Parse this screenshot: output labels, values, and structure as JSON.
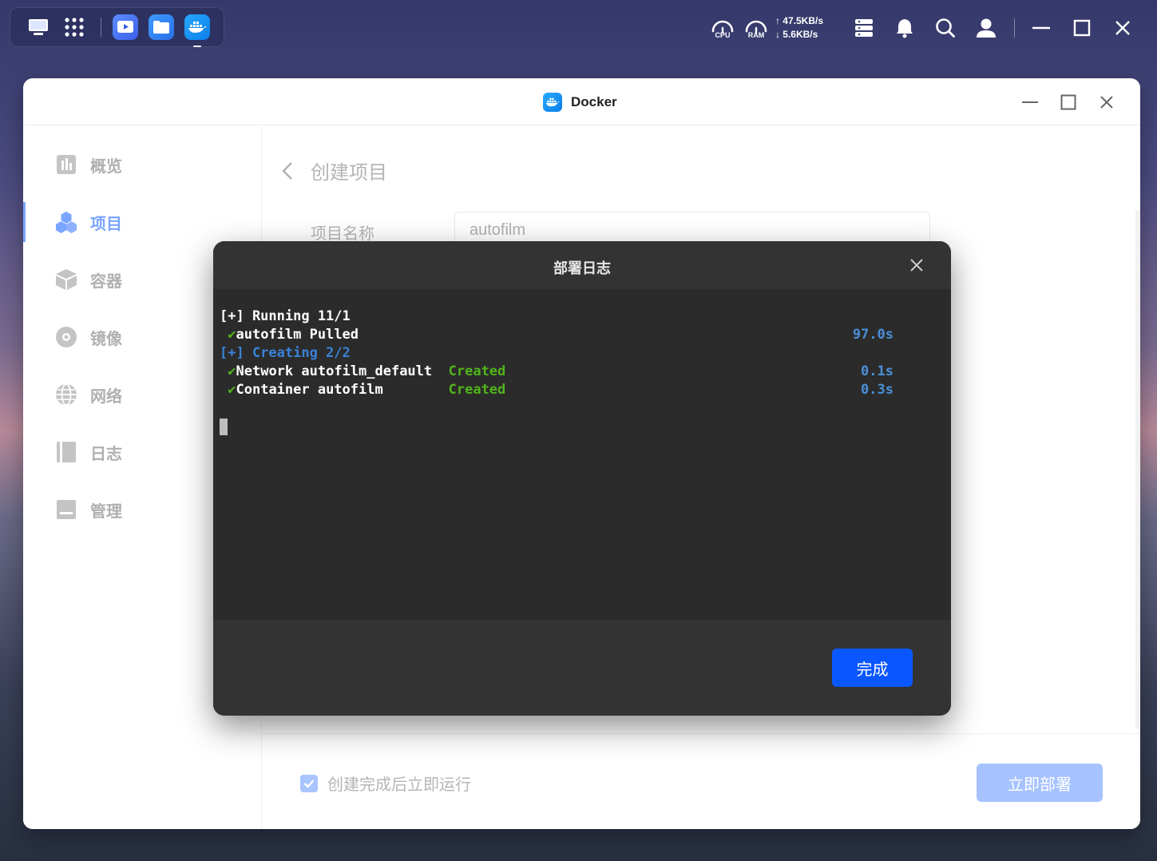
{
  "taskbar": {
    "apps": [
      {
        "name": "video-app"
      },
      {
        "name": "files-app"
      },
      {
        "name": "docker-app"
      }
    ]
  },
  "status": {
    "cpu_label": "CPU",
    "ram_label": "RAM",
    "upload": "47.5KB/s",
    "download": "5.6KB/s"
  },
  "window": {
    "title": "Docker"
  },
  "sidebar": {
    "items": [
      {
        "label": "概览",
        "icon": "chart-icon"
      },
      {
        "label": "项目",
        "icon": "cubes-icon",
        "active": true
      },
      {
        "label": "容器",
        "icon": "box-icon"
      },
      {
        "label": "镜像",
        "icon": "disc-icon"
      },
      {
        "label": "网络",
        "icon": "globe-icon"
      },
      {
        "label": "日志",
        "icon": "log-icon"
      },
      {
        "label": "管理",
        "icon": "manage-icon"
      }
    ]
  },
  "content": {
    "page_title": "创建项目",
    "project_name_label": "项目名称",
    "project_name_value": "autofilm",
    "run_after_create_label": "创建完成后立即运行",
    "run_after_create_checked": true,
    "deploy_button": "立即部署"
  },
  "modal": {
    "title": "部署日志",
    "log": {
      "running": "[+] Running 11/1",
      "pulled_check": "✔",
      "pulled": "autofilm Pulled",
      "pulled_time": "97.0s",
      "creating": "[+] Creating 2/2",
      "network_check": "✔",
      "network_name": "Network autofilm_default",
      "network_status": "Created",
      "network_time": "0.1s",
      "container_check": "✔",
      "container_name": "Container autofilm",
      "container_status": "Created",
      "container_time": "0.3s"
    },
    "done_button": "完成"
  },
  "colors": {
    "accent": "#0b57ff",
    "sidebar_active": "#7aa5ff",
    "term_green": "#50b41a",
    "term_blue": "#3a82d8"
  }
}
